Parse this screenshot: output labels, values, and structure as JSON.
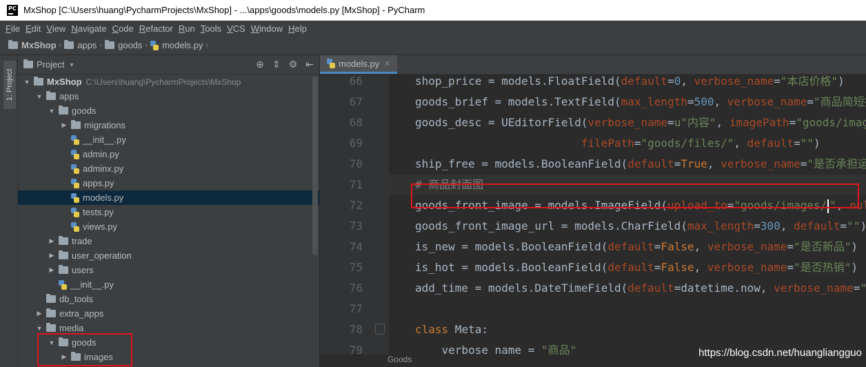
{
  "window": {
    "title": "MxShop [C:\\Users\\huang\\PycharmProjects\\MxShop] - ...\\apps\\goods\\models.py [MxShop] - PyCharm"
  },
  "menubar": [
    "File",
    "Edit",
    "View",
    "Navigate",
    "Code",
    "Refactor",
    "Run",
    "Tools",
    "VCS",
    "Window",
    "Help"
  ],
  "breadcrumb": [
    "MxShop",
    "apps",
    "goods",
    "models.py"
  ],
  "sidestripe": {
    "label": "1: Project"
  },
  "project_panel": {
    "title": "Project"
  },
  "tree": [
    {
      "label": "MxShop",
      "path": "C:\\Users\\huang\\PycharmProjects\\MxShop",
      "type": "folder",
      "depth": 0,
      "expanded": true
    },
    {
      "label": "apps",
      "type": "folder",
      "depth": 1,
      "expanded": true
    },
    {
      "label": "goods",
      "type": "folder",
      "depth": 2,
      "expanded": true
    },
    {
      "label": "migrations",
      "type": "folder",
      "depth": 3,
      "expanded": false
    },
    {
      "label": "__init__.py",
      "type": "py",
      "depth": 3
    },
    {
      "label": "admin.py",
      "type": "py",
      "depth": 3
    },
    {
      "label": "adminx.py",
      "type": "py",
      "depth": 3
    },
    {
      "label": "apps.py",
      "type": "py",
      "depth": 3
    },
    {
      "label": "models.py",
      "type": "py",
      "depth": 3,
      "selected": true
    },
    {
      "label": "tests.py",
      "type": "py",
      "depth": 3
    },
    {
      "label": "views.py",
      "type": "py",
      "depth": 3
    },
    {
      "label": "trade",
      "type": "folder",
      "depth": 2,
      "expanded": false
    },
    {
      "label": "user_operation",
      "type": "folder",
      "depth": 2,
      "expanded": false
    },
    {
      "label": "users",
      "type": "folder",
      "depth": 2,
      "expanded": false
    },
    {
      "label": "__init__.py",
      "type": "py",
      "depth": 2
    },
    {
      "label": "db_tools",
      "type": "folder",
      "depth": 1,
      "leaf": true
    },
    {
      "label": "extra_apps",
      "type": "folder",
      "depth": 1,
      "expanded": false
    },
    {
      "label": "media",
      "type": "folder",
      "depth": 1,
      "expanded": true
    },
    {
      "label": "goods",
      "type": "folder",
      "depth": 2,
      "expanded": true
    },
    {
      "label": "images",
      "type": "folder",
      "depth": 3,
      "expanded": false
    }
  ],
  "editor": {
    "tab": "models.py",
    "lines": [
      {
        "n": "66",
        "html": "shop_price = models.FloatField(<span class='param'>default</span>=<span class='num'>0</span>, <span class='param'>verbose_name</span>=<span class='str'>\"本店价格\"</span>)"
      },
      {
        "n": "67",
        "html": "goods_brief = models.TextField(<span class='param'>max_length</span>=<span class='num'>500</span>, <span class='param'>verbose_name</span>=<span class='str'>\"商品简短描述\"</span>)"
      },
      {
        "n": "68",
        "html": "goods_desc = UEditorField(<span class='param'>verbose_name</span>=<span class='str'>u\"内容\"</span>, <span class='param'>imagePath</span>=<span class='str'>\"goods/images/\"</span>"
      },
      {
        "n": "69",
        "html": "                         <span class='param'>filePath</span>=<span class='str'>\"goods/files/\"</span>, <span class='param'>default</span>=<span class='str'>\"\"</span>)"
      },
      {
        "n": "70",
        "html": "ship_free = models.BooleanField(<span class='param'>default</span>=<span class='kw'>True</span>, <span class='param'>verbose_name</span>=<span class='str'>\"是否承担运费\"</span>)"
      },
      {
        "n": "71",
        "html": "<span class='comment'># 商品封面图</span>"
      },
      {
        "n": "72",
        "html": "goods_front_image = models.ImageField(<span class='param'>upload_to</span>=<span class='str'>\"goods/images/<span class='caret'></span>\"</span>, <span class='param'>null</span>=<span class='kw'>True</span>)"
      },
      {
        "n": "73",
        "html": "goods_front_image_url = models.CharField(<span class='param'>max_length</span>=<span class='num'>300</span>, <span class='param'>default</span>=<span class='str'>\"\"</span>)"
      },
      {
        "n": "74",
        "html": "is_new = models.BooleanField(<span class='param'>default</span>=<span class='kw'>False</span>, <span class='param'>verbose_name</span>=<span class='str'>\"是否新品\"</span>)"
      },
      {
        "n": "75",
        "html": "is_hot = models.BooleanField(<span class='param'>default</span>=<span class='kw'>False</span>, <span class='param'>verbose_name</span>=<span class='str'>\"是否热销\"</span>)"
      },
      {
        "n": "76",
        "html": "add_time = models.DateTimeField(<span class='param'>default</span>=datetime.now, <span class='param'>verbose_name</span>=<span class='str'>\"添加时间\"</span>)"
      },
      {
        "n": "77",
        "html": ""
      },
      {
        "n": "78",
        "html": "<span class='cls'>class</span> Meta:"
      },
      {
        "n": "79",
        "html": "    verbose_name = <span class='str'>\"商品\"</span>"
      }
    ]
  },
  "status_strip": "Goods",
  "watermark": "https://blog.csdn.net/huangliangguo"
}
